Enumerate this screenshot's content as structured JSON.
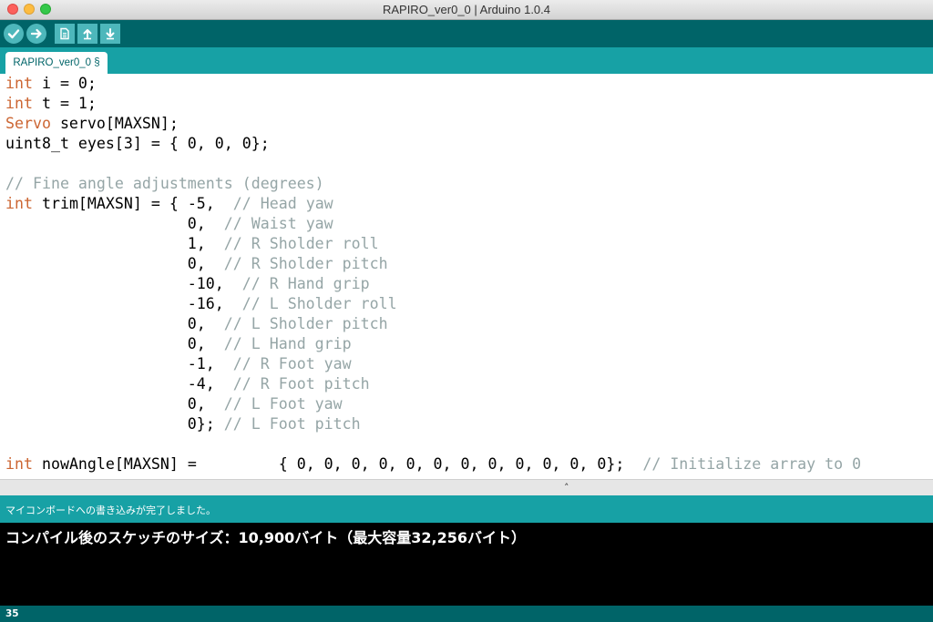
{
  "window": {
    "title": "RAPIRO_ver0_0 | Arduino 1.0.4"
  },
  "toolbar": {
    "buttons": [
      {
        "icon": "check-icon"
      },
      {
        "icon": "arrow-right-icon"
      },
      {
        "icon": "new-file-icon"
      },
      {
        "icon": "open-icon"
      },
      {
        "icon": "save-icon"
      }
    ]
  },
  "tab": {
    "label": "RAPIRO_ver0_0 §"
  },
  "code_lines": [
    [
      {
        "t": "int",
        "c": "kw-type"
      },
      {
        "t": " i = 0;"
      }
    ],
    [
      {
        "t": "int",
        "c": "kw-type"
      },
      {
        "t": " t = 1;"
      }
    ],
    [
      {
        "t": "Servo",
        "c": "kw-class"
      },
      {
        "t": " servo[MAXSN];"
      }
    ],
    [
      {
        "t": "uint8_t eyes[3] = { 0, 0, 0};"
      }
    ],
    [],
    [
      {
        "t": "// Fine angle adjustments (degrees)",
        "c": "comment"
      }
    ],
    [
      {
        "t": "int",
        "c": "kw-type"
      },
      {
        "t": " trim[MAXSN] = { -5,  "
      },
      {
        "t": "// Head yaw",
        "c": "comment"
      }
    ],
    [
      {
        "t": "                    0,  "
      },
      {
        "t": "// Waist yaw",
        "c": "comment"
      }
    ],
    [
      {
        "t": "                    1,  "
      },
      {
        "t": "// R Sholder roll",
        "c": "comment"
      }
    ],
    [
      {
        "t": "                    0,  "
      },
      {
        "t": "// R Sholder pitch",
        "c": "comment"
      }
    ],
    [
      {
        "t": "                    -10,  "
      },
      {
        "t": "// R Hand grip",
        "c": "comment"
      }
    ],
    [
      {
        "t": "                    -16,  "
      },
      {
        "t": "// L Sholder roll",
        "c": "comment"
      }
    ],
    [
      {
        "t": "                    0,  "
      },
      {
        "t": "// L Sholder pitch",
        "c": "comment"
      }
    ],
    [
      {
        "t": "                    0,  "
      },
      {
        "t": "// L Hand grip",
        "c": "comment"
      }
    ],
    [
      {
        "t": "                    -1,  "
      },
      {
        "t": "// R Foot yaw",
        "c": "comment"
      }
    ],
    [
      {
        "t": "                    -4,  "
      },
      {
        "t": "// R Foot pitch",
        "c": "comment"
      }
    ],
    [
      {
        "t": "                    0,  "
      },
      {
        "t": "// L Foot yaw",
        "c": "comment"
      }
    ],
    [
      {
        "t": "                    0}; "
      },
      {
        "t": "// L Foot pitch",
        "c": "comment"
      }
    ],
    [],
    [
      {
        "t": "int",
        "c": "kw-type"
      },
      {
        "t": " nowAngle[MAXSN] =         { 0, 0, 0, 0, 0, 0, 0, 0, 0, 0, 0, 0};  "
      },
      {
        "t": "// Initialize array to 0",
        "c": "comment"
      }
    ]
  ],
  "message": "マイコンボードへの書き込みが完了しました。",
  "console": "コンパイル後のスケッチのサイズ：10,900バイト（最大容量32,256バイト）",
  "status": {
    "line_number": "35"
  }
}
